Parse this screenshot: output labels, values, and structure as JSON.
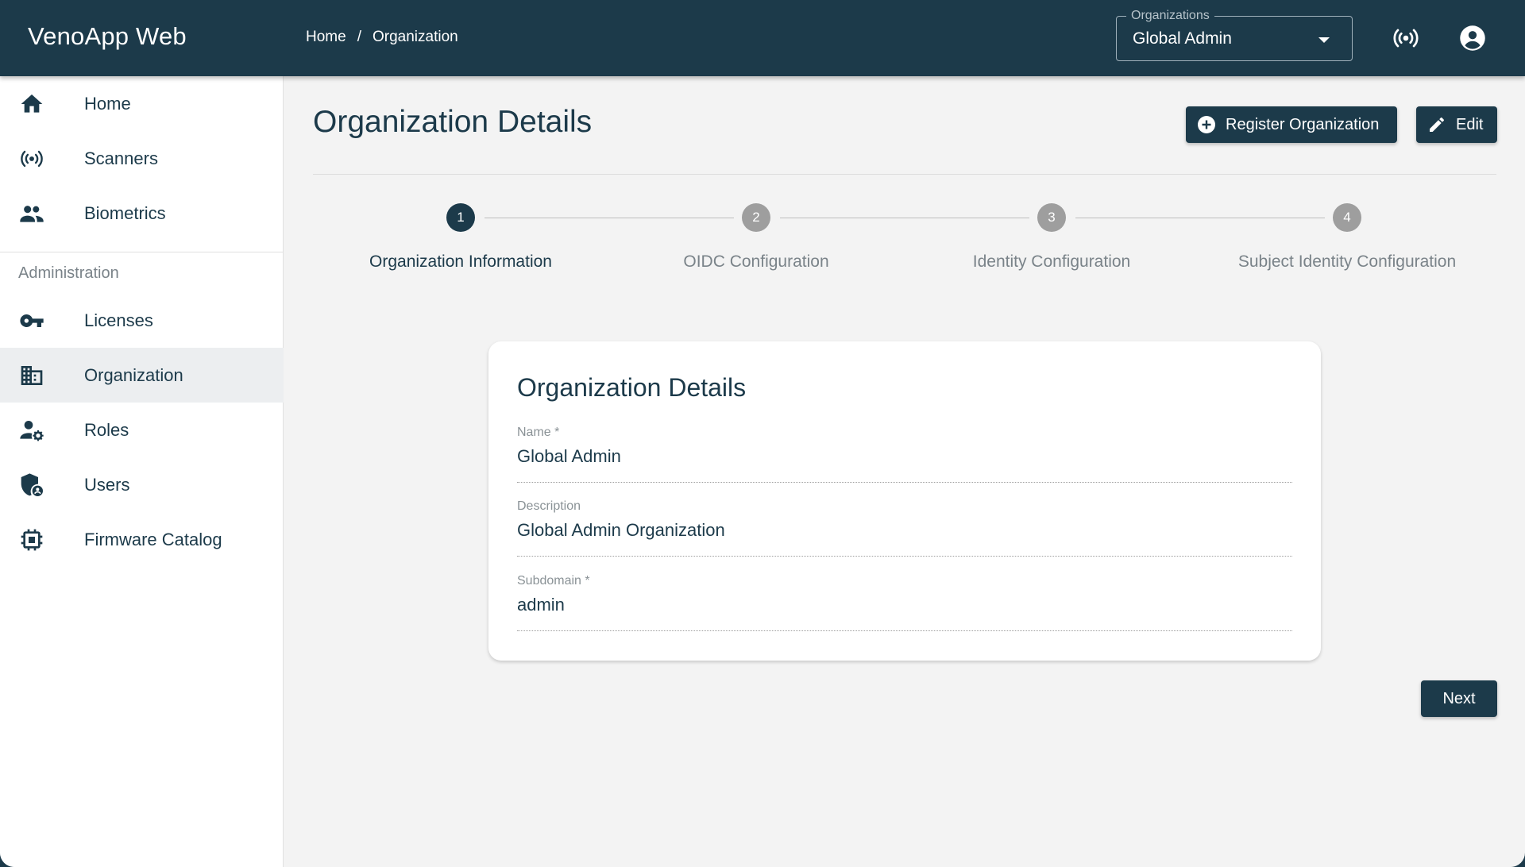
{
  "app": {
    "title": "VenoApp Web"
  },
  "breadcrumb": {
    "items": [
      "Home",
      "Organization"
    ],
    "separator": "/"
  },
  "org_selector": {
    "label": "Organizations",
    "value": "Global Admin"
  },
  "colors": {
    "primary": "#1c3a4a",
    "background": "#f3f3f3",
    "inactive_step": "#9e9e9e"
  },
  "sidebar": {
    "items": [
      {
        "label": "Home",
        "icon": "home-icon"
      },
      {
        "label": "Scanners",
        "icon": "broadcast-icon"
      },
      {
        "label": "Biometrics",
        "icon": "people-icon"
      }
    ],
    "section_title": "Administration",
    "admin_items": [
      {
        "label": "Licenses",
        "icon": "key-icon"
      },
      {
        "label": "Organization",
        "icon": "building-icon",
        "active": true
      },
      {
        "label": "Roles",
        "icon": "user-gear-icon"
      },
      {
        "label": "Users",
        "icon": "shield-user-icon"
      },
      {
        "label": "Firmware Catalog",
        "icon": "chip-icon"
      }
    ]
  },
  "main": {
    "title": "Organization Details",
    "register_button": "Register Organization",
    "edit_button": "Edit",
    "stepper": [
      {
        "number": "1",
        "label": "Organization Information",
        "active": true
      },
      {
        "number": "2",
        "label": "OIDC Configuration"
      },
      {
        "number": "3",
        "label": "Identity Configuration"
      },
      {
        "number": "4",
        "label": "Subject Identity Configuration"
      }
    ],
    "card": {
      "title": "Organization Details",
      "fields": [
        {
          "label": "Name *",
          "value": "Global Admin"
        },
        {
          "label": "Description",
          "value": "Global Admin Organization"
        },
        {
          "label": "Subdomain *",
          "value": "admin"
        }
      ]
    },
    "next_button": "Next"
  }
}
